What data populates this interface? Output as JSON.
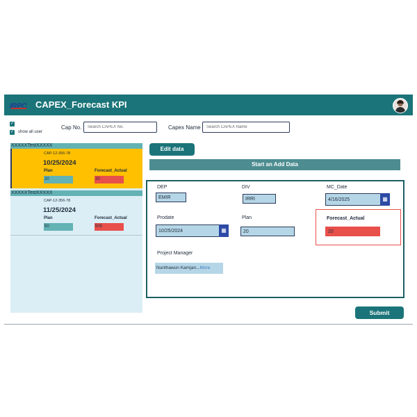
{
  "header": {
    "title": "CAPEX_Forecast KPI",
    "logo_text": "IRPC"
  },
  "filters": {
    "show_all_user_label": "show all user",
    "cap_no_label": "Cap No.",
    "cap_no_placeholder": "Search CAPEX No.",
    "capex_name_label": "Capex Name",
    "capex_name_placeholder": "Search CAPEX Name"
  },
  "cards": [
    {
      "name": "XXXXXTestXXXXX",
      "cap_no": "CAP-12-356-78",
      "date": "10/25/2024",
      "plan_label": "Plan",
      "plan_value": "20",
      "forecast_label": "Forecast_Actual",
      "forecast_value": "20"
    },
    {
      "name": "XXXXXTestXXXXX",
      "cap_no": "CAP-12-356-78",
      "date": "11/25/2024",
      "plan_label": "Plan",
      "plan_value": "50",
      "forecast_label": "Forecast_Actual",
      "forecast_value": "505"
    }
  ],
  "actions": {
    "edit_label": "Edit data",
    "banner": "Start an Add Data",
    "submit_label": "Submit"
  },
  "form": {
    "dep_label": "DEP",
    "dep_value": "EMIR",
    "div_label": "DIV",
    "div_value": "IRRI",
    "mc_date_label": "MC_Date",
    "mc_date_value": "4/16/2025",
    "prodate_label": "Prodate",
    "prodate_value": "10/25/2024",
    "plan_label": "Plan",
    "plan_value": "20",
    "forecast_label": "Forecast_Actual",
    "forecast_value": "20",
    "pm_label": "Project Manager",
    "pm_value": "Nunthawun Karnjan...",
    "pm_more": "More"
  },
  "colors": {
    "header": "#1b7479",
    "selected_card": "#ffc000",
    "card_bg": "#dbeef5",
    "red": "#e8504b",
    "teal_field": "#63b2b4"
  },
  "icons": {
    "calendar": "calendar-icon",
    "checkbox": "checkbox-icon",
    "avatar": "user-avatar"
  }
}
